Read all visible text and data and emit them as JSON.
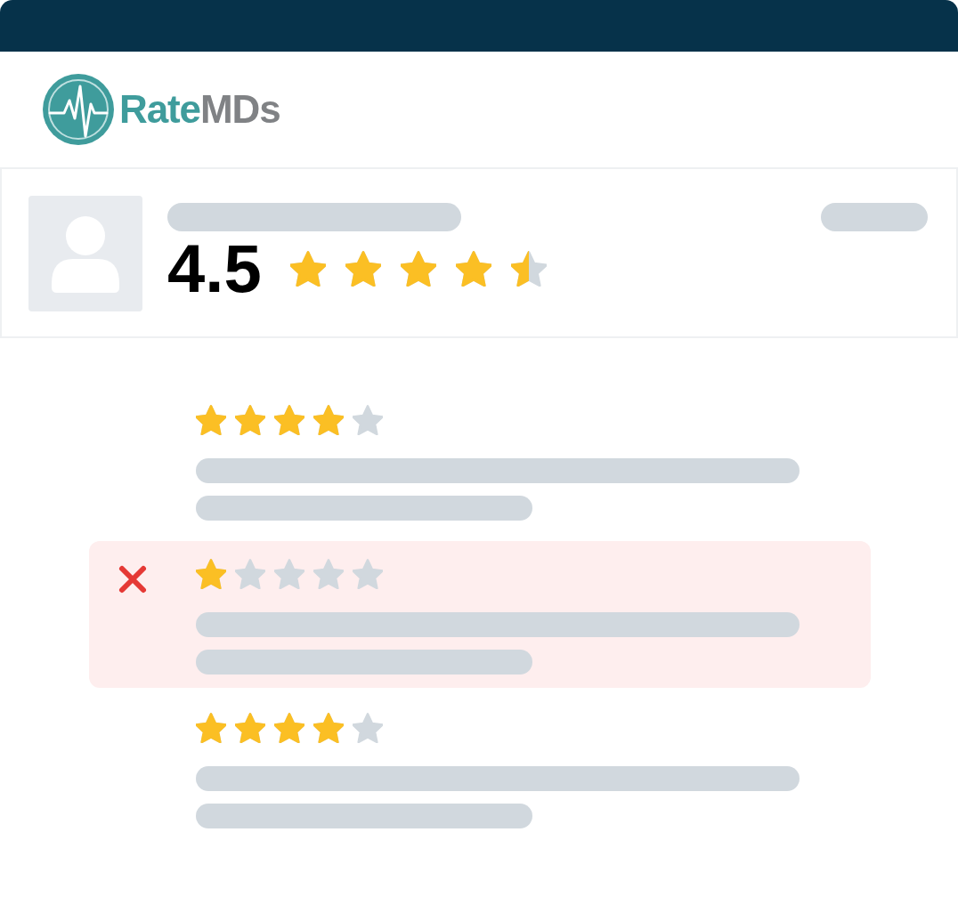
{
  "logo": {
    "text_1": "Rate",
    "text_2": "MDs"
  },
  "profile": {
    "rating": "4.5",
    "stars": 4.5
  },
  "reviews": [
    {
      "stars": 4,
      "flagged": false
    },
    {
      "stars": 1,
      "flagged": true
    },
    {
      "stars": 4,
      "flagged": false
    }
  ]
}
